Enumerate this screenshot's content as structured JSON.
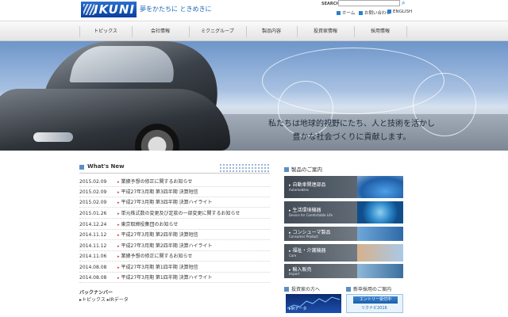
{
  "header": {
    "logo_text": "IKUNI",
    "tagline": "夢をかたちに ときめきに",
    "search_label": "SEARCH",
    "utility_links": [
      "ホーム",
      "お問い合わせ",
      "ENGLISH"
    ]
  },
  "nav": {
    "items": [
      "トピックス",
      "会社情報",
      "ミクニグループ",
      "製品内容",
      "投資家情報",
      "採用情報"
    ]
  },
  "hero": {
    "line1": "私たちは地球的視野にたち、人と技術を活かし",
    "line2": "豊かな社会づくりに貢献します。"
  },
  "news": {
    "title": "What's New",
    "items": [
      {
        "date": "2015.02.09",
        "title": "業績予想の修正に関するお知らせ"
      },
      {
        "date": "2015.02.09",
        "title": "平成27年3月期 第3四半期 決算短信"
      },
      {
        "date": "2015.02.09",
        "title": "平成27年3月期 第3四半期 決算ハイライト"
      },
      {
        "date": "2015.01.26",
        "title": "単元株式数の変更及び定款の一部変更に関するお知らせ"
      },
      {
        "date": "2014.12.24",
        "title": "東京取締役集団のお知らせ"
      },
      {
        "date": "2014.11.12",
        "title": "平成27年3月期 第2四半期 決算短信"
      },
      {
        "date": "2014.11.12",
        "title": "平成27年3月期 第2四半期 決算ハイライト"
      },
      {
        "date": "2014.11.06",
        "title": "業績予想の修正に関するお知らせ"
      },
      {
        "date": "2014.08.08",
        "title": "平成27年3月期 第1四半期 決算短信"
      },
      {
        "date": "2014.08.08",
        "title": "平成27年3月期 第1四半期 決算ハイライト"
      }
    ],
    "backnumber_title": "バックナンバー",
    "backnumber_links": "▸トピックス ▸IRデータ"
  },
  "products": {
    "title": "製品のご案内",
    "items": [
      {
        "label": "自動車関連部品",
        "sub": "Automobiles"
      },
      {
        "label": "生活環境機器",
        "sub": "Device for Comfortable Life"
      },
      {
        "label": "コンシューマ製品",
        "sub": "Consumer Product"
      },
      {
        "label": "福祉・介護機器",
        "sub": "Care"
      },
      {
        "label": "輸入販売",
        "sub": "Import"
      }
    ]
  },
  "ir": {
    "title": "投資家の方へ",
    "banner": "▸IRデータ"
  },
  "recruit": {
    "title": "新卒採用のご案内",
    "entry": "エントリー受付中",
    "year": "リクナビ2016"
  }
}
